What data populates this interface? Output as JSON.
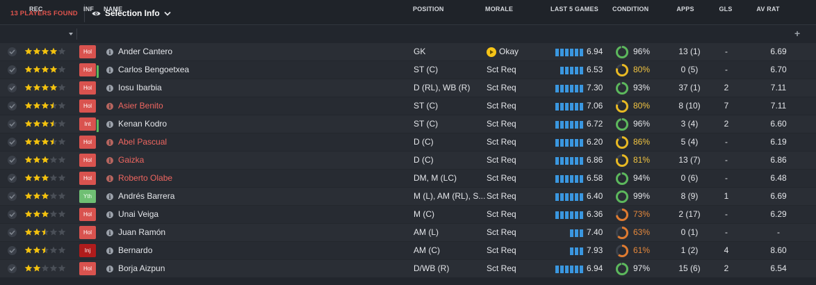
{
  "top": {
    "players_found": "13 PLAYERS FOUND",
    "view_label": "Selection Info"
  },
  "colors": {
    "accent_red": "#e0544d",
    "star": "#f4c20d",
    "form_bar": "#3a97e0",
    "cond_green": "#5cb85c",
    "cond_yellow": "#e8b923",
    "cond_orange": "#e07b30"
  },
  "columns": {
    "rec": "REC",
    "inf": "INF",
    "name": "NAME",
    "position": "POSITION",
    "morale": "MORALE",
    "last5": "LAST 5 GAMES",
    "condition": "CONDITION",
    "apps": "APPS",
    "gls": "GLS",
    "avrat": "AV RAT",
    "add": "+"
  },
  "players": [
    {
      "rec": 4.0,
      "inf": "Hol",
      "inf_type": "hol",
      "ext": false,
      "name": "Ander Cantero",
      "name_red": false,
      "position": "GK",
      "morale": "Okay",
      "morale_icon": true,
      "form_bars": 6,
      "last5": "6.94",
      "condition": "96%",
      "condition_value": 0.96,
      "cond_color": "green",
      "apps": "13 (1)",
      "gls": "-",
      "avrat": "6.69"
    },
    {
      "rec": 4.0,
      "inf": "Hol",
      "inf_type": "hol",
      "ext": true,
      "name": "Carlos Bengoetxea",
      "name_red": false,
      "position": "ST (C)",
      "morale": "Sct Req",
      "morale_icon": false,
      "form_bars": 5,
      "last5": "6.53",
      "condition": "80%",
      "condition_value": 0.8,
      "cond_color": "yellow",
      "apps": "0 (5)",
      "gls": "-",
      "avrat": "6.70"
    },
    {
      "rec": 4.0,
      "inf": "Hol",
      "inf_type": "hol",
      "ext": false,
      "name": "Iosu Ibarbia",
      "name_red": false,
      "position": "D (RL), WB (R)",
      "morale": "Sct Req",
      "morale_icon": false,
      "form_bars": 6,
      "last5": "7.30",
      "condition": "93%",
      "condition_value": 0.93,
      "cond_color": "green",
      "apps": "37 (1)",
      "gls": "2",
      "avrat": "7.11"
    },
    {
      "rec": 3.5,
      "inf": "Hol",
      "inf_type": "hol",
      "ext": false,
      "name": "Asier Benito",
      "name_red": true,
      "position": "ST (C)",
      "morale": "Sct Req",
      "morale_icon": false,
      "form_bars": 6,
      "last5": "7.06",
      "condition": "80%",
      "condition_value": 0.8,
      "cond_color": "yellow",
      "apps": "8 (10)",
      "gls": "7",
      "avrat": "7.11"
    },
    {
      "rec": 3.5,
      "inf": "Int",
      "inf_type": "int",
      "ext": true,
      "name": "Kenan Kodro",
      "name_red": false,
      "position": "ST (C)",
      "morale": "Sct Req",
      "morale_icon": false,
      "form_bars": 6,
      "last5": "6.72",
      "condition": "96%",
      "condition_value": 0.96,
      "cond_color": "green",
      "apps": "3 (4)",
      "gls": "2",
      "avrat": "6.60"
    },
    {
      "rec": 3.5,
      "inf": "Hol",
      "inf_type": "hol",
      "ext": false,
      "name": "Abel Pascual",
      "name_red": true,
      "position": "D (C)",
      "morale": "Sct Req",
      "morale_icon": false,
      "form_bars": 6,
      "last5": "6.20",
      "condition": "86%",
      "condition_value": 0.86,
      "cond_color": "yellow",
      "apps": "5 (4)",
      "gls": "-",
      "avrat": "6.19"
    },
    {
      "rec": 3.0,
      "inf": "Hol",
      "inf_type": "hol",
      "ext": false,
      "name": "Gaizka",
      "name_red": true,
      "position": "D (C)",
      "morale": "Sct Req",
      "morale_icon": false,
      "form_bars": 6,
      "last5": "6.86",
      "condition": "81%",
      "condition_value": 0.81,
      "cond_color": "yellow",
      "apps": "13 (7)",
      "gls": "-",
      "avrat": "6.86"
    },
    {
      "rec": 3.0,
      "inf": "Hol",
      "inf_type": "hol",
      "ext": false,
      "name": "Roberto Olabe",
      "name_red": true,
      "position": "DM, M (LC)",
      "morale": "Sct Req",
      "morale_icon": false,
      "form_bars": 6,
      "last5": "6.58",
      "condition": "94%",
      "condition_value": 0.94,
      "cond_color": "green",
      "apps": "0 (6)",
      "gls": "-",
      "avrat": "6.48"
    },
    {
      "rec": 3.0,
      "inf": "Yth",
      "inf_type": "yth",
      "ext": false,
      "name": "Andrés Barrera",
      "name_red": false,
      "position": "M (L), AM (RL), S...",
      "morale": "Sct Req",
      "morale_icon": false,
      "form_bars": 6,
      "last5": "6.40",
      "condition": "99%",
      "condition_value": 0.99,
      "cond_color": "green",
      "apps": "8 (9)",
      "gls": "1",
      "avrat": "6.69"
    },
    {
      "rec": 3.0,
      "inf": "Hol",
      "inf_type": "hol",
      "ext": false,
      "name": "Unai Veiga",
      "name_red": false,
      "position": "M (C)",
      "morale": "Sct Req",
      "morale_icon": false,
      "form_bars": 6,
      "last5": "6.36",
      "condition": "73%",
      "condition_value": 0.73,
      "cond_color": "orange",
      "apps": "2 (17)",
      "gls": "-",
      "avrat": "6.29"
    },
    {
      "rec": 2.5,
      "inf": "Hol",
      "inf_type": "hol",
      "ext": false,
      "name": "Juan Ramón",
      "name_red": false,
      "position": "AM (L)",
      "morale": "Sct Req",
      "morale_icon": false,
      "form_bars": 3,
      "last5": "7.40",
      "condition": "63%",
      "condition_value": 0.63,
      "cond_color": "orange",
      "apps": "0 (1)",
      "gls": "-",
      "avrat": "-"
    },
    {
      "rec": 2.5,
      "inf": "Inj",
      "inf_type": "inj",
      "ext": false,
      "name": "Bernardo",
      "name_red": false,
      "position": "AM (C)",
      "morale": "Sct Req",
      "morale_icon": false,
      "form_bars": 3,
      "last5": "7.93",
      "condition": "61%",
      "condition_value": 0.61,
      "cond_color": "orange",
      "apps": "1 (2)",
      "gls": "4",
      "avrat": "8.60"
    },
    {
      "rec": 2.0,
      "inf": "Hol",
      "inf_type": "hol",
      "ext": false,
      "name": "Borja Aizpun",
      "name_red": false,
      "position": "D/WB (R)",
      "morale": "Sct Req",
      "morale_icon": false,
      "form_bars": 6,
      "last5": "6.94",
      "condition": "97%",
      "condition_value": 0.97,
      "cond_color": "green",
      "apps": "15 (6)",
      "gls": "2",
      "avrat": "6.54"
    }
  ]
}
